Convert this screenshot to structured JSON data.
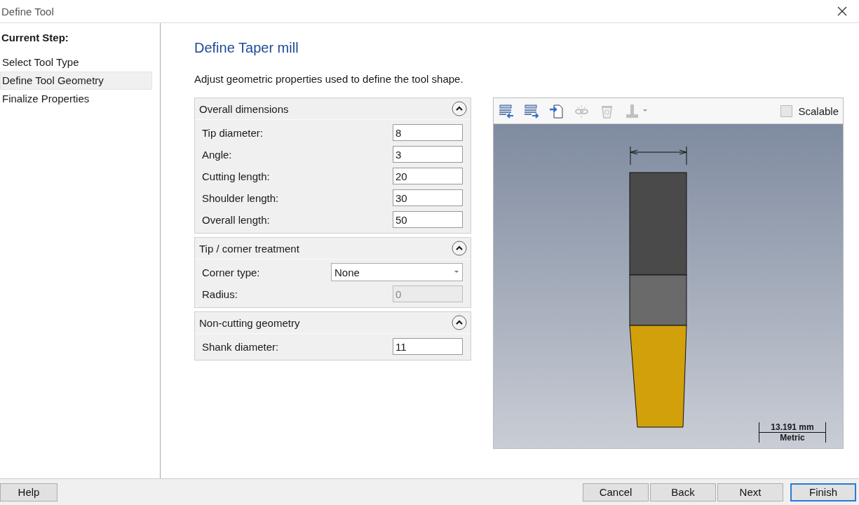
{
  "window": {
    "title": "Define Tool"
  },
  "sidebar": {
    "heading": "Current Step:",
    "items": [
      {
        "label": "Select Tool Type",
        "selected": false
      },
      {
        "label": "Define Tool Geometry",
        "selected": true
      },
      {
        "label": "Finalize Properties",
        "selected": false
      }
    ]
  },
  "page": {
    "title": "Define Taper mill",
    "description": "Adjust geometric properties used to define the tool shape."
  },
  "groups": [
    {
      "title": "Overall dimensions",
      "expanded": true,
      "fields": [
        {
          "kind": "text",
          "label": "Tip diameter:",
          "value": "8",
          "disabled": false
        },
        {
          "kind": "text",
          "label": "Angle:",
          "value": "3",
          "disabled": false
        },
        {
          "kind": "text",
          "label": "Cutting length:",
          "value": "20",
          "disabled": false
        },
        {
          "kind": "text",
          "label": "Shoulder length:",
          "value": "30",
          "disabled": false
        },
        {
          "kind": "text",
          "label": "Overall length:",
          "value": "50",
          "disabled": false
        }
      ]
    },
    {
      "title": "Tip / corner treatment",
      "expanded": true,
      "fields": [
        {
          "kind": "dropdown",
          "label": "Corner type:",
          "value": "None"
        },
        {
          "kind": "text",
          "label": "Radius:",
          "value": "0",
          "disabled": true
        }
      ]
    },
    {
      "title": "Non-cutting geometry",
      "expanded": true,
      "fields": [
        {
          "kind": "text",
          "label": "Shank diameter:",
          "value": "11",
          "disabled": false
        }
      ]
    }
  ],
  "preview": {
    "toolbar": [
      {
        "kind": "import",
        "disabled": false
      },
      {
        "kind": "export",
        "disabled": false
      },
      {
        "kind": "document",
        "disabled": false
      },
      {
        "kind": "link",
        "disabled": true
      },
      {
        "kind": "trash",
        "disabled": true
      },
      {
        "kind": "holder",
        "disabled": true
      }
    ],
    "scalable": {
      "label": "Scalable",
      "checked": false
    },
    "scale": {
      "value": "13.191 mm",
      "units": "Metric"
    }
  },
  "buttons": [
    {
      "label": "Help",
      "kind": "left",
      "default": false
    },
    {
      "label": "Cancel",
      "kind": "right",
      "default": false
    },
    {
      "label": "Back",
      "kind": "right",
      "default": false
    },
    {
      "label": "Next",
      "kind": "right",
      "default": false
    },
    {
      "label": "Finish",
      "kind": "right",
      "default": true
    }
  ]
}
